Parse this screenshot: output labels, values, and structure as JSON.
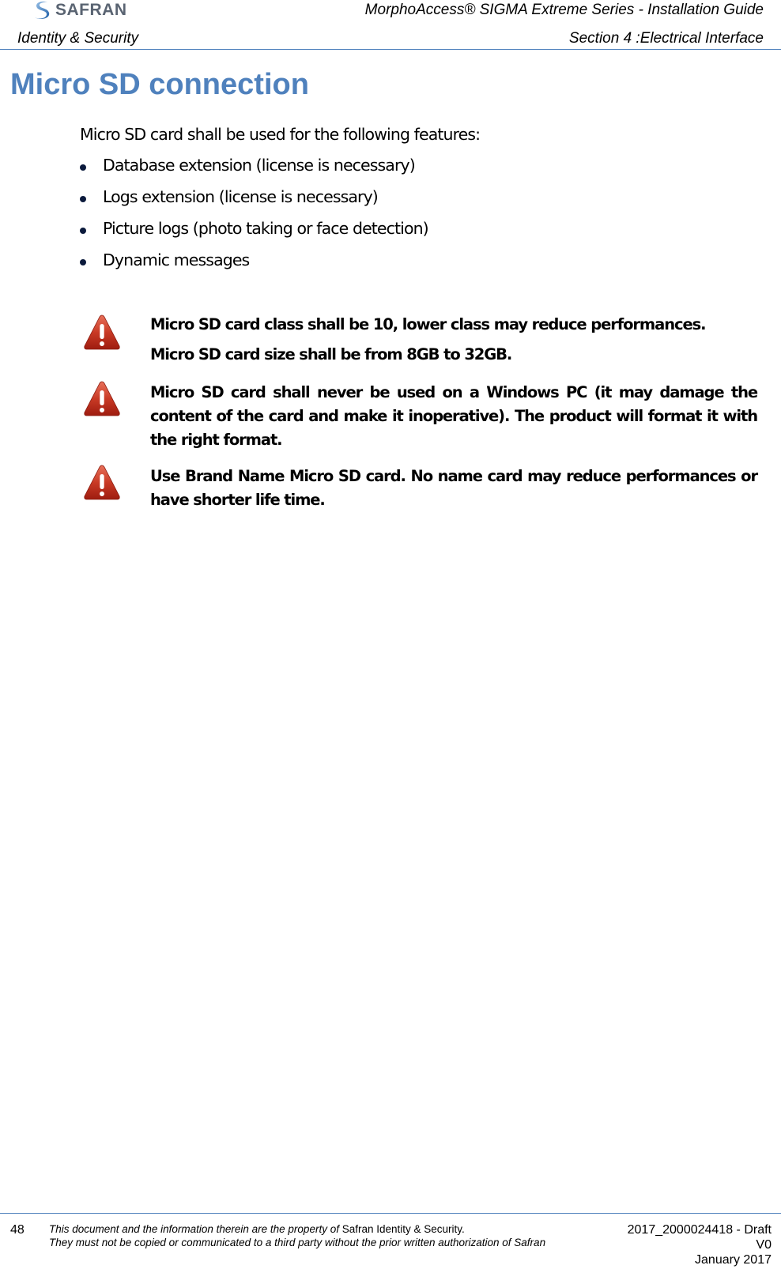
{
  "header": {
    "logo_text": "SAFRAN",
    "doc_title": "MorphoAccess® SIGMA Extreme Series - Installation Guide",
    "company": "Identity & Security",
    "section": "Section 4 :Electrical Interface"
  },
  "colors": {
    "accent": "#4f81bd",
    "warning_red": "#c0392b",
    "logo_gray": "#5a6472"
  },
  "main": {
    "heading": "Micro SD connection",
    "intro": "Micro SD card shall be used for the following features:",
    "features": [
      "Database extension (license is necessary)",
      "Logs extension (license is necessary)",
      "Picture logs (photo taking or face detection)",
      "Dynamic messages"
    ],
    "warnings": [
      {
        "icon": "warning-triangle-icon",
        "lines": [
          "Micro SD card class shall be 10, lower class may reduce performances.",
          "Micro SD card size shall be from 8GB to 32GB."
        ]
      },
      {
        "icon": "warning-triangle-icon",
        "lines": [
          "Micro SD card shall never be used on a Windows PC (it may damage the content of the card and make it inoperative). The product will format it with the right format."
        ]
      },
      {
        "icon": "warning-triangle-icon",
        "lines": [
          "Use Brand Name Micro SD card. No name card may reduce performances or have shorter life time."
        ]
      }
    ]
  },
  "footer": {
    "page_number": "48",
    "legal_line1_italic": "This document and the information therein are the property of ",
    "legal_line1_plain": "Safran Identity & Security.",
    "legal_line2": "They must not be copied or communicated to a third party without the prior written authorization of Safran",
    "doc_ref": "2017_2000024418 - Draft",
    "version": "V0",
    "date": "January 2017"
  }
}
